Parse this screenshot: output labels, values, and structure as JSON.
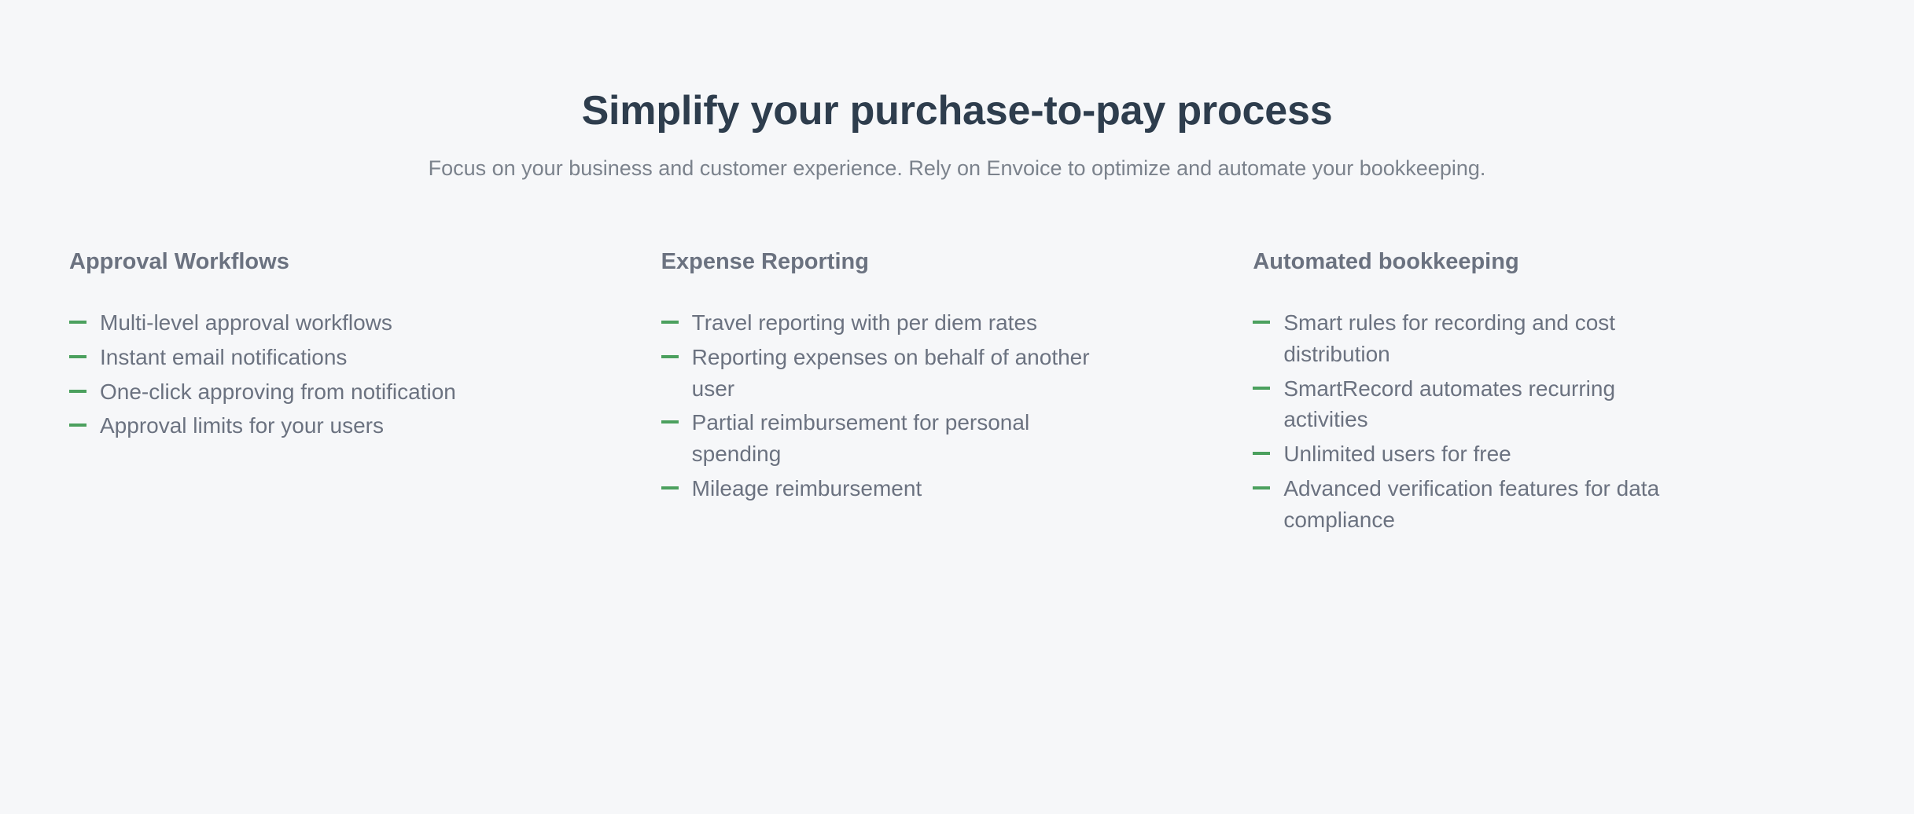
{
  "header": {
    "title": "Simplify your purchase-to-pay process",
    "subtitle": "Focus on your business and customer experience. Rely on Envoice to optimize and automate your bookkeeping."
  },
  "colors": {
    "background": "#f6f7f9",
    "title": "#2e3d4d",
    "subtitle": "#7b828c",
    "body_text": "#6b7280",
    "bullet_dash": "#4ba05e"
  },
  "icons": {
    "bullet": "dash-icon"
  },
  "columns": [
    {
      "title": "Approval Workflows",
      "items": [
        "Multi-level approval workflows",
        "Instant email notifications",
        "One-click approving from notification",
        "Approval limits for your users"
      ]
    },
    {
      "title": "Expense Reporting",
      "items": [
        "Travel reporting with per diem rates",
        "Reporting expenses on behalf of another user",
        "Partial reimbursement for personal spending",
        "Mileage reimbursement"
      ]
    },
    {
      "title": "Automated bookkeeping",
      "items": [
        "Smart rules for recording and cost distribution",
        "SmartRecord automates recurring activities",
        "Unlimited users for free",
        "Advanced verification features for data compliance"
      ]
    }
  ]
}
